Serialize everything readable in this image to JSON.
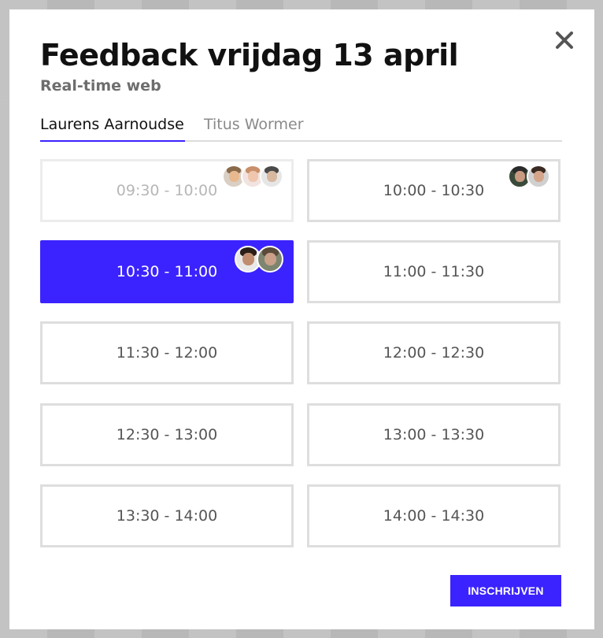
{
  "modal": {
    "title": "Feedback vrijdag 13 april",
    "subtitle": "Real-time web",
    "close_icon": "close-icon"
  },
  "tabs": [
    {
      "label": "Laurens Aarnoudse",
      "active": true
    },
    {
      "label": "Titus Wormer",
      "active": false
    }
  ],
  "slots": [
    {
      "time": "09:30 - 10:00",
      "state": "disabled",
      "avatars": 3
    },
    {
      "time": "10:00 - 10:30",
      "state": "available",
      "avatars": 2
    },
    {
      "time": "10:30 - 11:00",
      "state": "selected",
      "avatars": 2
    },
    {
      "time": "11:00 - 11:30",
      "state": "available",
      "avatars": 0
    },
    {
      "time": "11:30 - 12:00",
      "state": "available",
      "avatars": 0
    },
    {
      "time": "12:00 - 12:30",
      "state": "available",
      "avatars": 0
    },
    {
      "time": "12:30 - 13:00",
      "state": "available",
      "avatars": 0
    },
    {
      "time": "13:00 - 13:30",
      "state": "available",
      "avatars": 0
    },
    {
      "time": "13:30 - 14:00",
      "state": "available",
      "avatars": 0
    },
    {
      "time": "14:00 - 14:30",
      "state": "available",
      "avatars": 0
    }
  ],
  "actions": {
    "submit_label": "INSCHRIJVEN"
  },
  "colors": {
    "accent": "#3b23ff",
    "slot_border": "#dedede",
    "text_muted": "#6d6d6d"
  }
}
